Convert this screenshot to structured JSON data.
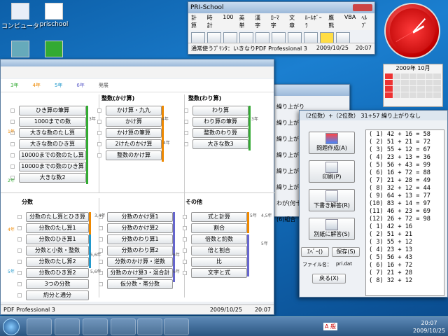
{
  "desktop": {
    "icons": [
      {
        "label": "コンピュータ"
      },
      {
        "label": "prischool"
      },
      {
        "label": ""
      },
      {
        "label": ""
      }
    ]
  },
  "clock": {
    "hour": 20,
    "minute": 7
  },
  "calendar": {
    "header": "2009年 10月"
  },
  "toolbar_window": {
    "title": "PRI-School",
    "menu": [
      "計算",
      "時計",
      "100",
      "英単",
      "漢字",
      "ﾛｰﾏ字",
      "文章",
      "ﾙｰﾙﾎﾞｰﾗ",
      "鷹熊",
      "VBA",
      "ﾍﾙﾌﾟ"
    ],
    "status": {
      "printer": "通常使うﾌﾟﾘﾝﾀ：いきなりPDF Professional 3",
      "date": "2009/10/25",
      "time": "20:07"
    }
  },
  "main_window": {
    "grades": [
      "3年",
      "4年",
      "5年",
      "6年",
      "発展"
    ],
    "sections": {
      "mul_int": "整数(かけ算)",
      "div_int": "整数(わり算)",
      "fraction": "分数",
      "other": "その他"
    },
    "col_left": [
      "ひき算の筆算",
      "1000までの数",
      "大きな数のたし算",
      "大きな数のひき算",
      "10000までの数のたし算",
      "10000までの数のひき算",
      "大きな数2"
    ],
    "col_mul": [
      "かけ算・九九",
      "かけ算",
      "かけ算の筆算",
      "2けたのかけ算",
      "整数のかけ算"
    ],
    "col_div": [
      "わり算",
      "わり算の筆算",
      "整数のわり算",
      "大きな数3"
    ],
    "frac1": [
      "分数のたし算とひき算",
      "分数のたし算1",
      "分数のひき算1",
      "分数と小数・整数",
      "分数のたし算2",
      "分数のひき算2",
      "3つの分数",
      "約分と通分"
    ],
    "frac2": [
      "分数のかけ算1",
      "分数のかけ算2",
      "分数のわり算1",
      "分数のわり算2",
      "分数のかけ算・逆数",
      "分数のかけ算3・混合計算",
      "仮分数・帯分数"
    ],
    "other": [
      "式と計算",
      "割合",
      "倍数と約数",
      "倍と割合",
      "比",
      "文字と式"
    ],
    "left_tags": [
      "1年",
      "2年",
      "4年",
      "5年"
    ],
    "tags_mid": [
      "3年",
      "4年",
      "3年",
      "3,4年",
      "4年",
      "5年",
      "6年",
      "5,6年",
      "5,6年",
      "6年",
      "4,5年",
      "5年"
    ],
    "status": {
      "printer": "PDF Professional 3",
      "date": "2009/10/25",
      "time": "20:07"
    }
  },
  "back_window": {
    "items": [
      "繰り上がり",
      "繰り上がり",
      "繰り上がり",
      "繰り上がり",
      "繰り上がり",
      "繰り上がり",
      "わが(何十",
      "(6)組合"
    ]
  },
  "dialog": {
    "title": "（2位数）+（2位数）  31+57    繰り上がりなし",
    "buttons": [
      "問題作成(A)",
      "印刷(P)",
      "下書き解答(R)",
      "別紙に解答(S)"
    ],
    "small_buttons": [
      "ｴﾍﾞｰ()",
      "保存(S)"
    ],
    "file_label": "ファイル名：",
    "file_name": "pri.dat",
    "back": "戻る(X)",
    "problems": [
      "( 1) 42 + 16 = 58",
      "( 2) 51 + 21 = 72",
      "( 3) 55 + 12 = 67",
      "( 4) 23 + 13 = 36",
      "( 5) 56 + 43 = 99",
      "( 6) 16 + 72 = 88",
      "( 7) 21 + 28 = 49",
      "( 8) 32 + 12 = 44",
      "( 9) 64 + 13 = 77",
      "(10) 83 + 14 = 97",
      "(11) 46 + 23 = 69",
      "(12) 26 + 72 = 98",
      "( 1) 42 + 16",
      "( 2) 51 + 21",
      "( 3) 55 + 12",
      "( 4) 23 + 13",
      "( 5) 56 + 43",
      "( 6) 16 + 72",
      "( 7) 21 + 28",
      "( 8) 32 + 12"
    ]
  },
  "taskbar": {
    "ime": "A 般",
    "time": "20:07",
    "date": "2009/10/25"
  }
}
